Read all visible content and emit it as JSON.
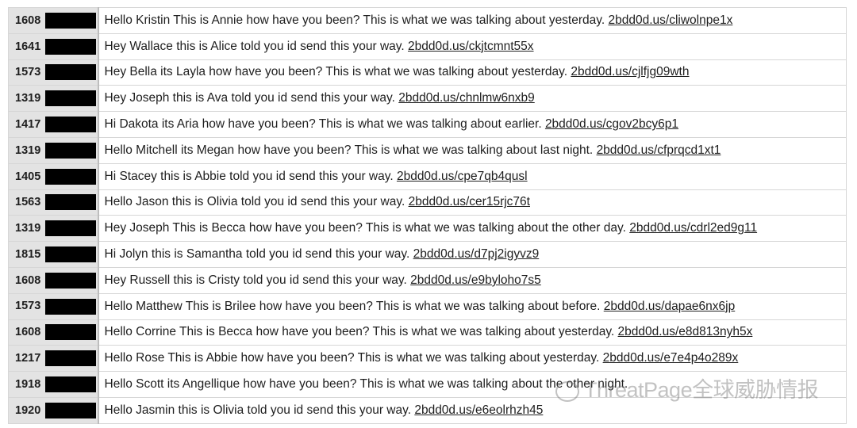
{
  "rows": [
    {
      "id": "1608",
      "text": "Hello Kristin This is Annie how have you been?  This is what we was talking about yesterday.",
      "link": "2bdd0d.us/cliwolnpe1x"
    },
    {
      "id": "1641",
      "text": "Hey Wallace this is Alice told you id send this your way. ",
      "link": "2bdd0d.us/ckjtcmnt55x"
    },
    {
      "id": "1573",
      "text": "Hey Bella its Layla how have you been?  This is what we was talking about yesterday.",
      "link": "2bdd0d.us/cjlfjg09wth"
    },
    {
      "id": "1319",
      "text": "Hey Joseph this is Ava told you id send this your way. ",
      "link": "2bdd0d.us/chnlmw6nxb9"
    },
    {
      "id": "1417",
      "text": "Hi Dakota its Aria how have you been?  This is what we was talking about earlier.",
      "link": "2bdd0d.us/cgov2bcy6p1"
    },
    {
      "id": "1319",
      "text": "Hello Mitchell its Megan how have you been?  This is what we was talking about last night.",
      "link": "2bdd0d.us/cfprqcd1xt1"
    },
    {
      "id": "1405",
      "text": "Hi Stacey this is Abbie told you id send this your way. ",
      "link": "2bdd0d.us/cpe7qb4qusl"
    },
    {
      "id": "1563",
      "text": "Hello Jason this is Olivia told you id send this your way. ",
      "link": "2bdd0d.us/cer15rjc76t"
    },
    {
      "id": "1319",
      "text": "Hey Joseph This is Becca how have you been?  This is what we was talking about the other day.",
      "link": "2bdd0d.us/cdrl2ed9g11"
    },
    {
      "id": "1815",
      "text": "Hi Jolyn this is Samantha told you id send this your way. ",
      "link": "2bdd0d.us/d7pj2igyvz9"
    },
    {
      "id": "1608",
      "text": "Hey Russell this is Cristy told you id send this your way. ",
      "link": "2bdd0d.us/e9byloho7s5"
    },
    {
      "id": "1573",
      "text": "Hello Matthew This is Brilee how have you been?  This is what we was talking about before.",
      "link": "2bdd0d.us/dapae6nx6jp"
    },
    {
      "id": "1608",
      "text": "Hello Corrine This is Becca how have you been?  This is what we was talking about yesterday.",
      "link": "2bdd0d.us/e8d813nyh5x"
    },
    {
      "id": "1217",
      "text": "Hello Rose This is Abbie how have you been?  This is what we was talking about yesterday.",
      "link": "2bdd0d.us/e7e4p4o289x"
    },
    {
      "id": "1918",
      "text": "Hello Scott its Angellique how have you been?  This is what we was talking about the other night.",
      "link": ""
    },
    {
      "id": "1920",
      "text": "Hello Jasmin this is Olivia told you id send this your way. ",
      "link": "2bdd0d.us/e6eolrhzh45"
    }
  ],
  "watermark": "ThreatPage全球威胁情报"
}
